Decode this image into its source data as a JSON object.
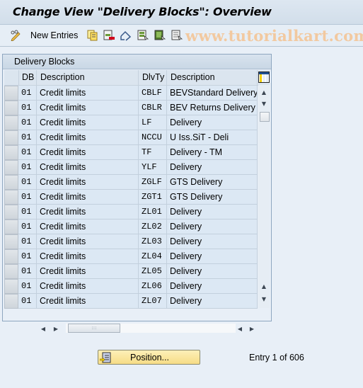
{
  "window": {
    "title": "Change View \"Delivery Blocks\": Overview"
  },
  "toolbar": {
    "new_entries_label": "New Entries",
    "icons": [
      "display-change-icon",
      "copy-as-icon",
      "delete-icon",
      "undo-change-icon",
      "select-all-icon",
      "select-block-icon",
      "deselect-all-icon"
    ]
  },
  "watermark": "www.tutorialkart.com",
  "table": {
    "title": "Delivery Blocks",
    "columns": [
      "DB",
      "Description",
      "DlvTy",
      "Description"
    ],
    "rows": [
      {
        "db": "01",
        "desc": "Credit limits",
        "dlvty": "CBLF",
        "dlvdesc": "BEVStandard Delivery"
      },
      {
        "db": "01",
        "desc": "Credit limits",
        "dlvty": "CBLR",
        "dlvdesc": "BEV Returns Delivery"
      },
      {
        "db": "01",
        "desc": "Credit limits",
        "dlvty": "LF",
        "dlvdesc": "Delivery"
      },
      {
        "db": "01",
        "desc": "Credit limits",
        "dlvty": "NCCU",
        "dlvdesc": "U Iss.SiT - Deli"
      },
      {
        "db": "01",
        "desc": "Credit limits",
        "dlvty": "TF",
        "dlvdesc": "Delivery - TM"
      },
      {
        "db": "01",
        "desc": "Credit limits",
        "dlvty": "YLF",
        "dlvdesc": "Delivery"
      },
      {
        "db": "01",
        "desc": "Credit limits",
        "dlvty": "ZGLF",
        "dlvdesc": "GTS Delivery"
      },
      {
        "db": "01",
        "desc": "Credit limits",
        "dlvty": "ZGT1",
        "dlvdesc": "GTS Delivery"
      },
      {
        "db": "01",
        "desc": "Credit limits",
        "dlvty": "ZL01",
        "dlvdesc": "Delivery"
      },
      {
        "db": "01",
        "desc": "Credit limits",
        "dlvty": "ZL02",
        "dlvdesc": "Delivery"
      },
      {
        "db": "01",
        "desc": "Credit limits",
        "dlvty": "ZL03",
        "dlvdesc": "Delivery"
      },
      {
        "db": "01",
        "desc": "Credit limits",
        "dlvty": "ZL04",
        "dlvdesc": "Delivery"
      },
      {
        "db": "01",
        "desc": "Credit limits",
        "dlvty": "ZL05",
        "dlvdesc": "Delivery"
      },
      {
        "db": "01",
        "desc": "Credit limits",
        "dlvty": "ZL06",
        "dlvdesc": "Delivery"
      },
      {
        "db": "01",
        "desc": "Credit limits",
        "dlvty": "ZL07",
        "dlvdesc": "Delivery"
      }
    ]
  },
  "footer": {
    "position_label": "Position...",
    "entry_text": "Entry 1 of 606"
  }
}
